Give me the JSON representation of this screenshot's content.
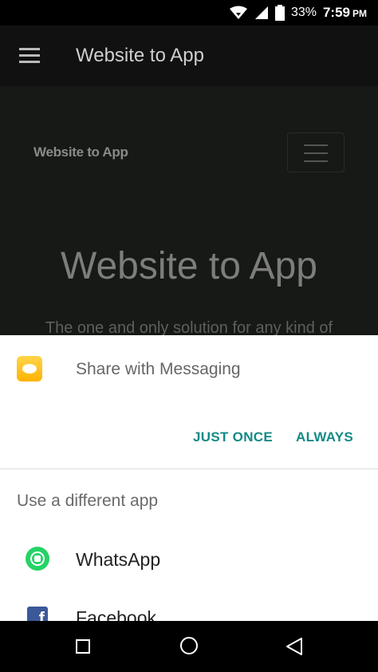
{
  "status_bar": {
    "battery": "33%",
    "time": "7:59",
    "ampm": "PM",
    "icons": [
      "wifi-icon",
      "signal-icon",
      "battery-icon"
    ]
  },
  "app_bar": {
    "title": "Website to App",
    "menu_icon": "menu-icon"
  },
  "webview": {
    "logo_text": "Website to App",
    "hero_title": "Website to App",
    "hero_subtitle": "The one and only solution for any kind of"
  },
  "share_sheet": {
    "title": "Share with Messaging",
    "app_icon": "messaging-icon",
    "just_once": "JUST ONCE",
    "always": "ALWAYS",
    "different_app_label": "Use a different app",
    "apps": [
      {
        "name": "WhatsApp",
        "icon": "whatsapp-icon"
      },
      {
        "name": "Facebook",
        "icon": "facebook-icon"
      }
    ]
  },
  "nav_bar": {
    "icons": [
      "recents-icon",
      "home-icon",
      "back-icon"
    ]
  },
  "colors": {
    "accent": "#148a85",
    "whatsapp": "#25d366",
    "facebook": "#3b5998",
    "messaging": "#ffc107"
  }
}
